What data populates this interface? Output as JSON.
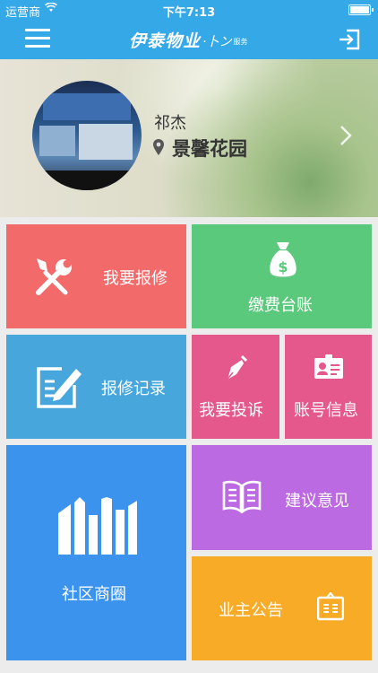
{
  "status_bar": {
    "carrier": "运营商",
    "wifi_icon": "wifi-icon",
    "time": "下午7:13",
    "battery_icon": "battery-icon"
  },
  "nav": {
    "brand_name": "伊泰物业",
    "brand_mark": "·卜ン",
    "brand_suffix": "服务",
    "menu_icon": "hamburger-menu-icon",
    "logout_icon": "logout-icon"
  },
  "profile": {
    "name": "祁杰",
    "community": "景馨花园",
    "location_icon": "location-pin-icon",
    "chevron_icon": "chevron-right-icon"
  },
  "tiles": {
    "repair": {
      "label": "我要报修",
      "icon": "wrench-screwdriver-icon",
      "color": "#f36a6b"
    },
    "fee": {
      "label": "缴费台账",
      "icon": "money-bag-icon",
      "color": "#5bc97c"
    },
    "records": {
      "label": "报修记录",
      "icon": "edit-note-icon",
      "color": "#47a7dd"
    },
    "complaint": {
      "label": "我要投诉",
      "icon": "pen-nib-icon",
      "color": "#e4588c"
    },
    "account": {
      "label": "账号信息",
      "icon": "id-card-icon",
      "color": "#e4588c"
    },
    "circle": {
      "label": "社区商圈",
      "icon": "buildings-icon",
      "color": "#3c93ee"
    },
    "suggest": {
      "label": "建议意见",
      "icon": "open-book-icon",
      "color": "#bb6ae2"
    },
    "notice": {
      "label": "业主公告",
      "icon": "notice-board-icon",
      "color": "#f8ab27"
    }
  }
}
